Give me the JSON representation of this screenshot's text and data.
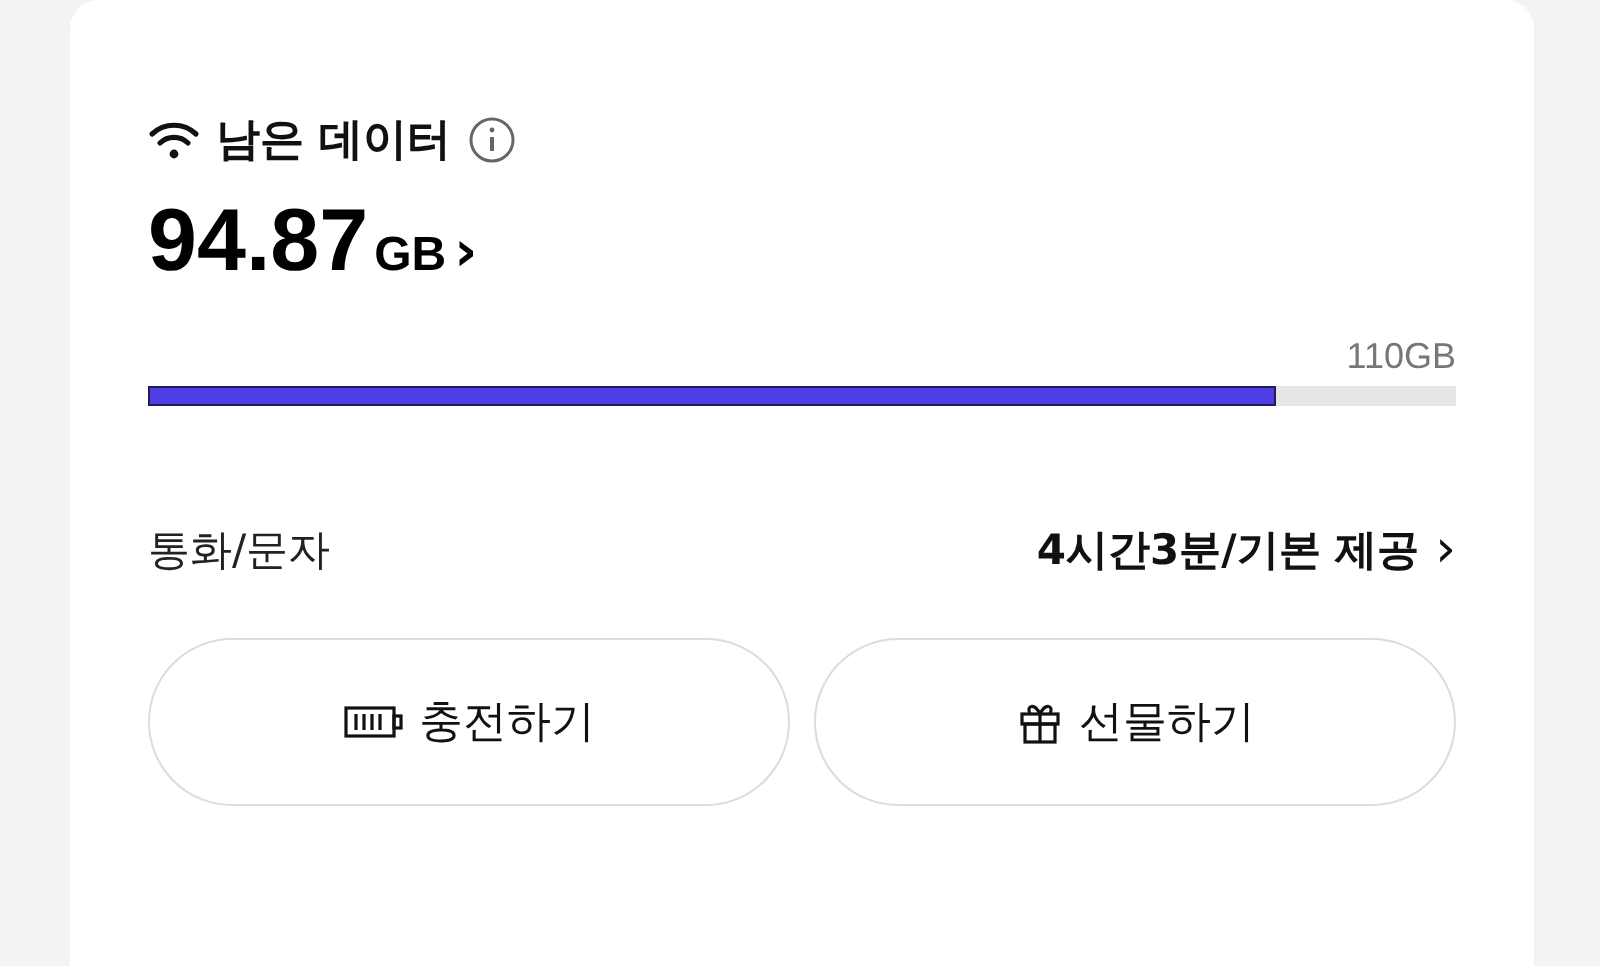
{
  "data_card": {
    "title": "남은 데이터",
    "remaining": {
      "amount": "94.87",
      "unit": "GB",
      "arrow": "›"
    },
    "total": "110GB",
    "usage": {
      "level": 0.8625
    },
    "call_text": {
      "label": "통화/문자",
      "value": "4시간3분/기본 제공",
      "arrow": "›"
    },
    "buttons": [
      {
        "kind": "charge",
        "label": "충전하기"
      },
      {
        "kind": "gift",
        "label": "선물하기"
      }
    ]
  }
}
